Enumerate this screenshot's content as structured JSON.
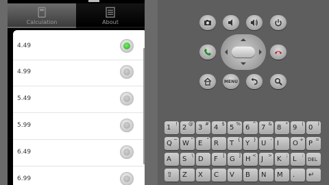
{
  "tabs": [
    {
      "label": "Calculation",
      "icon": "calculator-icon",
      "active": true
    },
    {
      "label": "About",
      "icon": "list-icon",
      "active": false
    }
  ],
  "list": {
    "items": [
      {
        "value": "4.49",
        "selected": true
      },
      {
        "value": "4.99",
        "selected": false
      },
      {
        "value": "5.49",
        "selected": false
      },
      {
        "value": "5.99",
        "selected": false
      },
      {
        "value": "6.49",
        "selected": false
      },
      {
        "value": "6.99",
        "selected": false
      }
    ]
  },
  "emulator": {
    "buttons": [
      {
        "name": "camera-button",
        "icon": "camera-icon"
      },
      {
        "name": "volume-down-button",
        "icon": "volume-down-icon"
      },
      {
        "name": "volume-up-button",
        "icon": "volume-up-icon"
      },
      {
        "name": "power-button",
        "icon": "power-icon"
      },
      {
        "name": "call-button",
        "icon": "phone-icon"
      },
      {
        "name": "end-call-button",
        "icon": "hangup-icon"
      },
      {
        "name": "home-button",
        "icon": "home-icon"
      },
      {
        "name": "menu-button",
        "icon": "menu-label",
        "label": "MENU"
      },
      {
        "name": "back-button",
        "icon": "back-icon"
      },
      {
        "name": "search-button",
        "icon": "search-icon"
      }
    ],
    "keyboard": {
      "row1": [
        {
          "main": "1",
          "sub": "!"
        },
        {
          "main": "2",
          "sub": "@"
        },
        {
          "main": "3",
          "sub": "#"
        },
        {
          "main": "4",
          "sub": "$"
        },
        {
          "main": "5",
          "sub": "%"
        },
        {
          "main": "6",
          "sub": "^"
        },
        {
          "main": "7",
          "sub": "&"
        },
        {
          "main": "8",
          "sub": "*"
        },
        {
          "main": "9",
          "sub": "("
        },
        {
          "main": "0",
          "sub": ")"
        }
      ],
      "row2": [
        {
          "main": "Q",
          "sub": "~"
        },
        {
          "main": "W",
          "sub": "\""
        },
        {
          "main": "E",
          "sub": "\""
        },
        {
          "main": "R",
          "sub": ""
        },
        {
          "main": "T",
          "sub": "{"
        },
        {
          "main": "Y",
          "sub": "}"
        },
        {
          "main": "U",
          "sub": "-"
        },
        {
          "main": "I",
          "sub": ""
        },
        {
          "main": "O",
          "sub": "+"
        },
        {
          "main": "P",
          "sub": "="
        }
      ],
      "row3": [
        {
          "main": "A",
          "sub": ""
        },
        {
          "main": "S",
          "sub": "\\"
        },
        {
          "main": "D",
          "sub": ""
        },
        {
          "main": "F",
          "sub": "["
        },
        {
          "main": "G",
          "sub": "]"
        },
        {
          "main": "H",
          "sub": "<"
        },
        {
          "main": "J",
          "sub": ">"
        },
        {
          "main": "K",
          "sub": ";"
        },
        {
          "main": "L",
          "sub": ":"
        },
        {
          "main": "DEL",
          "sub": ""
        }
      ],
      "row4": [
        {
          "main": "⇧",
          "sub": ""
        },
        {
          "main": "Z",
          "sub": ""
        },
        {
          "main": "X",
          "sub": ""
        },
        {
          "main": "C",
          "sub": ""
        },
        {
          "main": "V",
          "sub": ""
        },
        {
          "main": "B",
          "sub": ""
        },
        {
          "main": "N",
          "sub": ""
        },
        {
          "main": "M",
          "sub": ""
        },
        {
          "main": ".",
          "sub": ""
        },
        {
          "main": "↵",
          "sub": ""
        }
      ]
    }
  }
}
